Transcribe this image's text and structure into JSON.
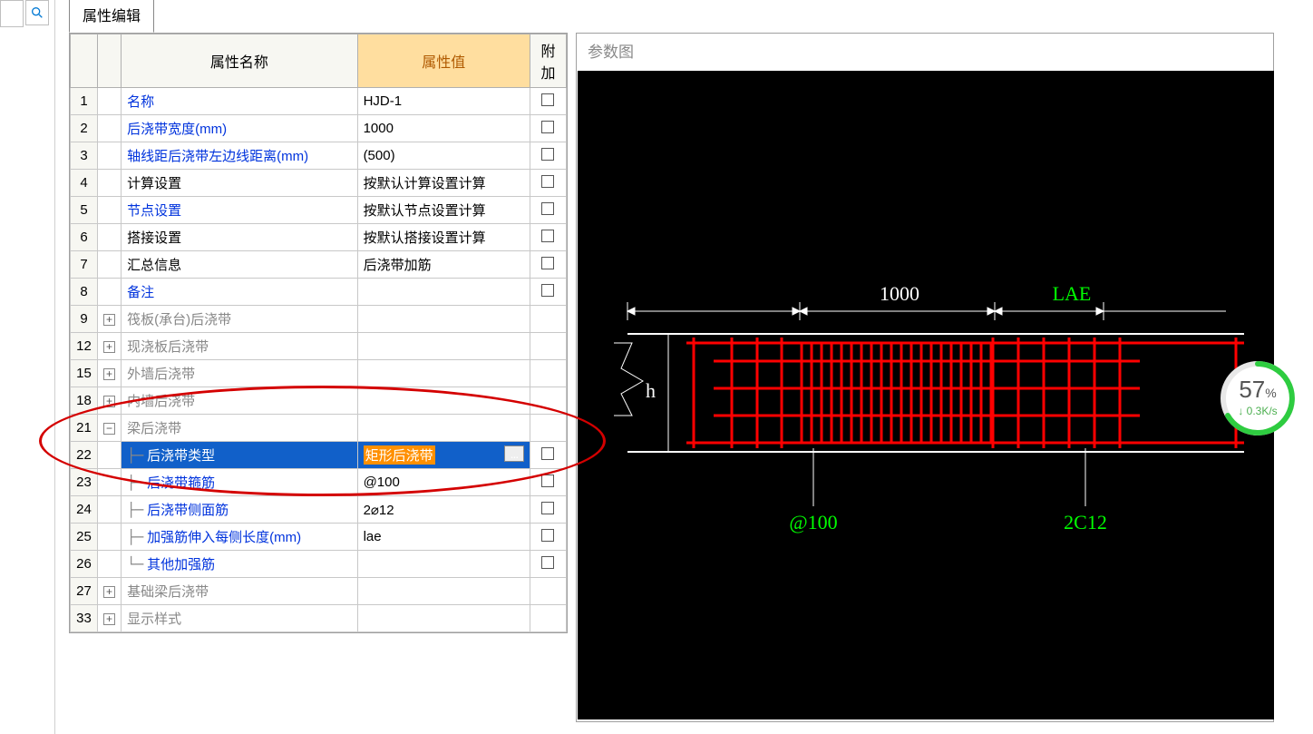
{
  "ui": {
    "tab_label": "属性编辑",
    "headers": {
      "name": "属性名称",
      "value": "属性值",
      "attach": "附加"
    },
    "right_title": "参数图",
    "ellips": "..."
  },
  "rows": [
    {
      "num": "1",
      "name": "名称",
      "blue": true,
      "val": "HJD-1",
      "chk": false
    },
    {
      "num": "2",
      "name": "后浇带宽度(mm)",
      "blue": true,
      "val": "1000",
      "chk": true
    },
    {
      "num": "3",
      "name": "轴线距后浇带左边线距离(mm)",
      "blue": true,
      "val": "(500)",
      "chk": true
    },
    {
      "num": "4",
      "name": "计算设置",
      "blue": false,
      "val": "按默认计算设置计算",
      "chk": false
    },
    {
      "num": "5",
      "name": "节点设置",
      "blue": true,
      "val": "按默认节点设置计算",
      "chk": false
    },
    {
      "num": "6",
      "name": "搭接设置",
      "blue": false,
      "val": "按默认搭接设置计算",
      "chk": false
    },
    {
      "num": "7",
      "name": "汇总信息",
      "blue": false,
      "val": "后浇带加筋",
      "chk": true
    },
    {
      "num": "8",
      "name": "备注",
      "blue": true,
      "val": "",
      "chk": true
    },
    {
      "num": "9",
      "exp": "+",
      "name": "筏板(承台)后浇带",
      "gray": true
    },
    {
      "num": "12",
      "exp": "+",
      "name": "现浇板后浇带",
      "gray": true
    },
    {
      "num": "15",
      "exp": "+",
      "name": "外墙后浇带",
      "gray": true
    },
    {
      "num": "18",
      "exp": "+",
      "name": "内墙后浇带",
      "gray": true
    },
    {
      "num": "21",
      "exp": "−",
      "name": "梁后浇带",
      "gray": true
    },
    {
      "num": "22",
      "tree": "├─",
      "name": "后浇带类型",
      "blue": true,
      "val_hl": "矩形后浇带",
      "selected": true,
      "ellipsis": true,
      "chk": true
    },
    {
      "num": "23",
      "tree": "├─",
      "name": "后浇带箍筋",
      "blue": true,
      "val": "@100",
      "chk": true
    },
    {
      "num": "24",
      "tree": "├─",
      "name": "后浇带侧面筋",
      "blue": true,
      "val": "2⌀12",
      "chk": true
    },
    {
      "num": "25",
      "tree": "├─",
      "name": "加强筋伸入每侧长度(mm)",
      "blue": true,
      "val": "lae",
      "chk": true
    },
    {
      "num": "26",
      "tree": "└─",
      "name": "其他加强筋",
      "blue": true,
      "val": "",
      "chk": false
    },
    {
      "num": "27",
      "exp": "+",
      "name": "基础梁后浇带",
      "gray": true
    },
    {
      "num": "33",
      "exp": "+",
      "name": "显示样式",
      "gray": true
    }
  ],
  "diagram": {
    "dim_top": "1000",
    "lae": "LAE",
    "h": "h",
    "stirrup_label": "@100",
    "side_label": "2C12"
  },
  "widget": {
    "percent": "57",
    "percent_unit": "%",
    "speed": "0.3K/s"
  }
}
